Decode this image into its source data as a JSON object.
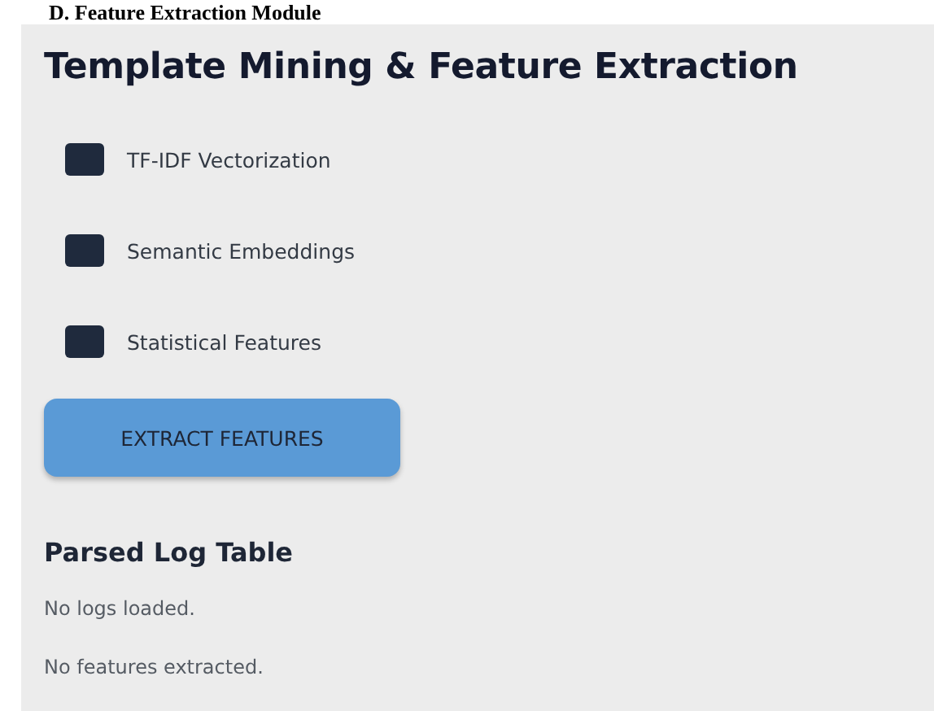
{
  "page_heading": "D. Feature Extraction Module",
  "panel": {
    "title": "Template Mining & Feature Extraction",
    "options": [
      {
        "label": "TF-IDF Vectorization",
        "checked": false
      },
      {
        "label": "Semantic Embeddings",
        "checked": false
      },
      {
        "label": "Statistical Features",
        "checked": false
      }
    ],
    "button": "EXTRACT FEATURES",
    "section_title": "Parsed Log Table",
    "messages": [
      "No logs loaded.",
      "No features extracted."
    ]
  }
}
